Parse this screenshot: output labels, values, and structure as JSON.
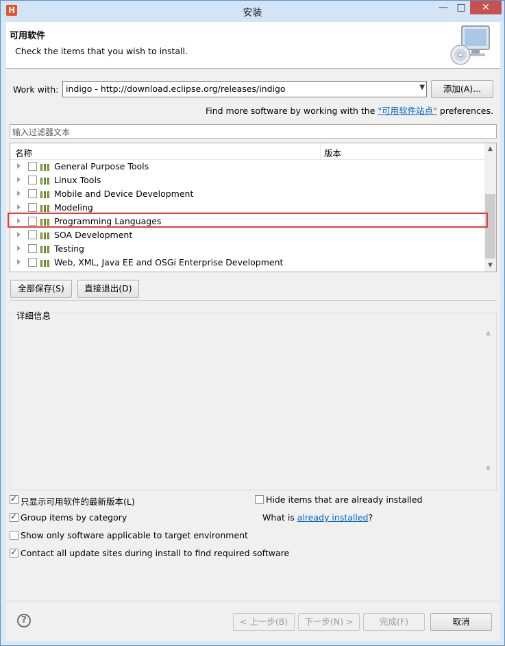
{
  "window": {
    "title": "安装",
    "app_icon": "H",
    "minimize_glyph": "—",
    "maximize_glyph": "□",
    "close_glyph": "✕"
  },
  "header": {
    "title": "可用软件",
    "description": "Check the items that you wish to install.",
    "icon": "install-cd-monitor-icon"
  },
  "work_with": {
    "label": "Work with:",
    "value": "indigo - http://download.eclipse.org/releases/indigo",
    "add_button": "添加(A)..."
  },
  "find_more": {
    "prefix": "Find more software by working with the ",
    "link": "\"可用软件站点\"",
    "suffix": " preferences."
  },
  "filter": {
    "placeholder": "输入过滤器文本"
  },
  "tree": {
    "columns": [
      "名称",
      "版本"
    ],
    "items": [
      {
        "label": "General Purpose Tools",
        "checked": false
      },
      {
        "label": "Linux Tools",
        "checked": false
      },
      {
        "label": "Mobile and Device Development",
        "checked": false
      },
      {
        "label": "Modeling",
        "checked": false
      },
      {
        "label": "Programming Languages",
        "checked": false,
        "highlighted": true
      },
      {
        "label": "SOA Development",
        "checked": false
      },
      {
        "label": "Testing",
        "checked": false
      },
      {
        "label": "Web, XML, Java EE and OSGi Enterprise Development",
        "checked": false
      }
    ]
  },
  "tree_buttons": {
    "select_all": "全部保存(S)",
    "deselect": "直接退出(D)"
  },
  "details": {
    "label": "详细信息"
  },
  "options": {
    "latest_versions": {
      "label": "只显示可用软件的最新版本(L)",
      "checked": true
    },
    "hide_installed": {
      "label": "Hide items that are already installed",
      "checked": false
    },
    "group_by_category": {
      "label": "Group items by category",
      "checked": true
    },
    "what_is_prefix": "What is ",
    "what_is_link": "already installed",
    "what_is_suffix": "?",
    "show_applicable": {
      "label": "Show only software applicable to target environment",
      "checked": false
    },
    "contact_sites": {
      "label": "Contact all update sites during install to find required software",
      "checked": true
    }
  },
  "footer": {
    "back": "< 上一步(B)",
    "next": "下一步(N) >",
    "finish": "完成(F)",
    "cancel": "取消",
    "help_glyph": "?"
  },
  "colors": {
    "highlight_border": "#e23b3b",
    "link": "#0066cc"
  }
}
